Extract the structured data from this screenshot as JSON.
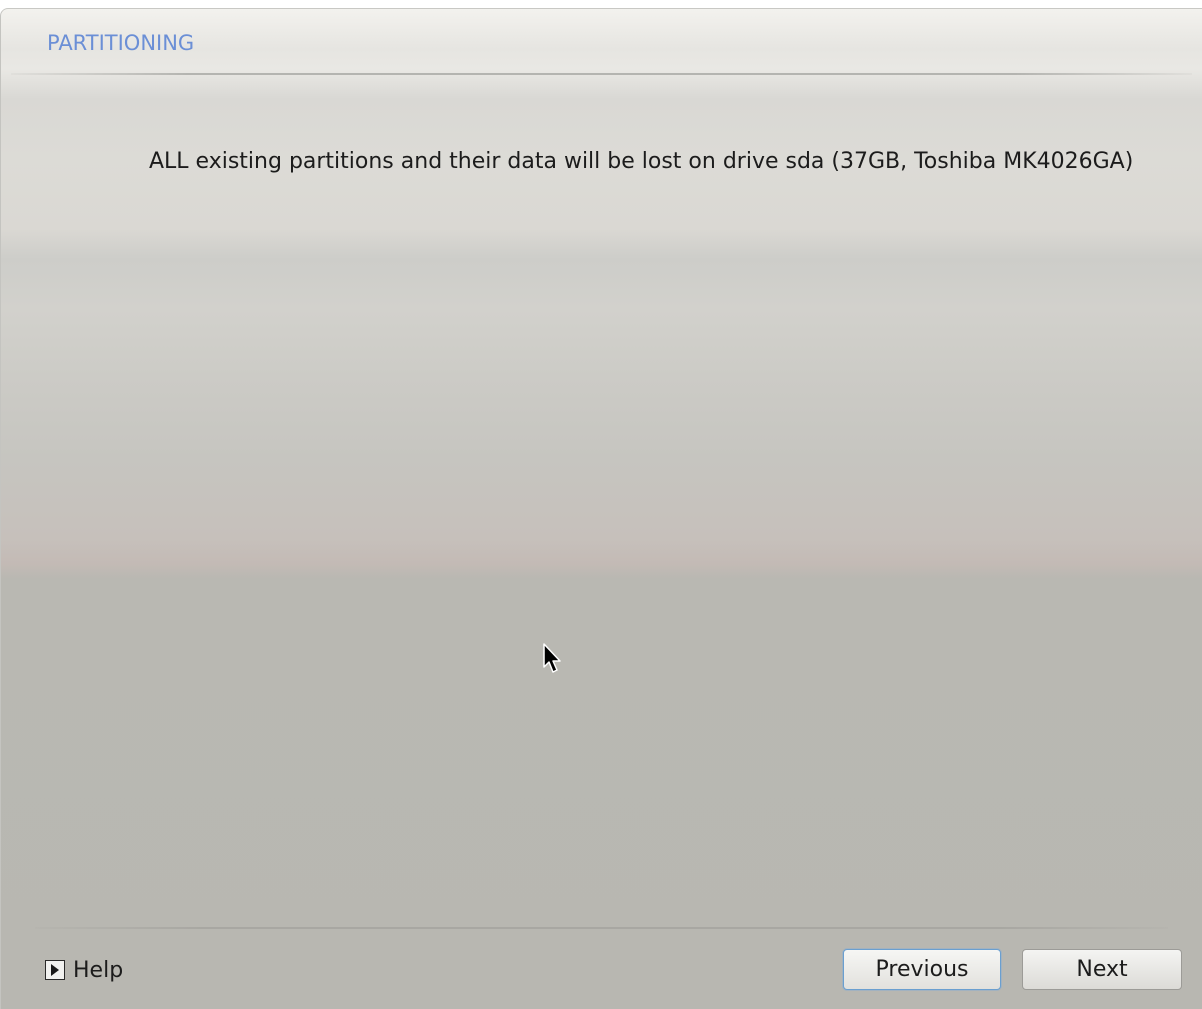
{
  "header": {
    "title": "PARTITIONING"
  },
  "main": {
    "message": "ALL existing partitions and their data will be lost on drive sda (37GB, Toshiba MK4026GA)"
  },
  "footer": {
    "help_label": "Help",
    "previous_label": "Previous",
    "next_label": "Next"
  },
  "icons": {
    "help_expander": "play-triangle-icon",
    "pointer": "mouse-cursor-icon"
  },
  "colors": {
    "title_accent": "#6b8fd6",
    "focus_border": "#6a9fd0"
  }
}
